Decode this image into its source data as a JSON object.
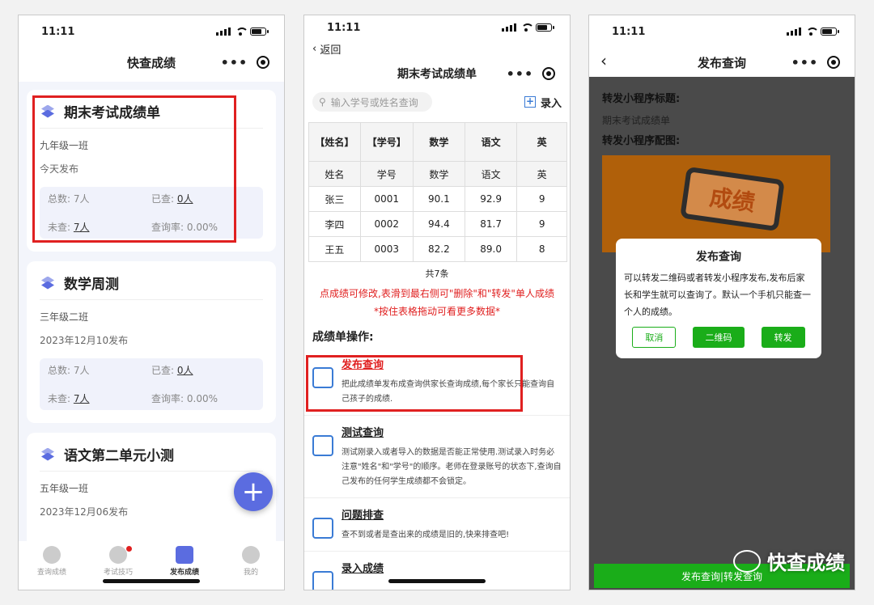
{
  "status": {
    "time": "11:11"
  },
  "screen1": {
    "title": "快查成绩",
    "cards": [
      {
        "title": "期末考试成绩单",
        "class": "九年级一班",
        "date": "今天发布",
        "total_label": "总数:",
        "total": "7人",
        "checked_label": "已查:",
        "checked": "0人",
        "unchecked_label": "未查:",
        "unchecked": "7人",
        "rate_label": "查询率:",
        "rate": "0.00%"
      },
      {
        "title": "数学周测",
        "class": "三年级二班",
        "date": "2023年12月10发布",
        "total_label": "总数:",
        "total": "7人",
        "checked_label": "已查:",
        "checked": "0人",
        "unchecked_label": "未查:",
        "unchecked": "7人",
        "rate_label": "查询率:",
        "rate": "0.00%"
      },
      {
        "title": "语文第二单元小测",
        "class": "五年级一班",
        "date": "2023年12月06发布"
      }
    ],
    "fab": "+",
    "tabs": [
      "查询成绩",
      "考试技巧",
      "发布成绩",
      "我的"
    ]
  },
  "screen2": {
    "back": "返回",
    "title": "期末考试成绩单",
    "search_placeholder": "输入学号或姓名查询",
    "add": "录入",
    "headers": [
      "【姓名】",
      "【学号】",
      "数学",
      "语文",
      "英"
    ],
    "rows": [
      [
        "姓名",
        "学号",
        "数学",
        "语文",
        "英"
      ],
      [
        "张三",
        "0001",
        "90.1",
        "92.9",
        "9"
      ],
      [
        "李四",
        "0002",
        "94.4",
        "81.7",
        "9"
      ],
      [
        "王五",
        "0003",
        "82.2",
        "89.0",
        "8"
      ]
    ],
    "count": "共7条",
    "note1": "点成绩可修改,表滑到最右侧可\"删除\"和\"转发\"单人成绩",
    "note2": "*按住表格拖动可看更多数据*",
    "ops_title": "成绩单操作:",
    "ops": [
      {
        "title": "发布查询",
        "desc": "把此成绩单发布成查询供家长查询成绩,每个家长只能查询自己孩子的成绩."
      },
      {
        "title": "测试查询",
        "desc": "测试刚录入或者导入的数据是否能正常使用.测试录入时务必注意\"姓名\"和\"学号\"的顺序。老师在登录账号的状态下,查询自己发布的任何学生成绩都不会锁定。"
      },
      {
        "title": "问题排查",
        "desc": "查不到或者是查出来的成绩是旧的,快来排查吧!"
      },
      {
        "title": "录入成绩",
        "desc": ""
      }
    ]
  },
  "screen3": {
    "title": "发布查询",
    "label1": "转发小程序标题:",
    "value1": "期末考试成绩单",
    "label2": "转发小程序配图:",
    "img_text": "成绩",
    "modal_title": "发布查询",
    "modal_body": "可以转发二维码或者转发小程序发布,发布后家长和学生就可以查询了。默认一个手机只能查一个人的成绩。",
    "btn_cancel": "取消",
    "btn_qr": "二维码",
    "btn_share": "转发",
    "bottom_btn": "发布查询|转发查询"
  },
  "watermark": "快查成绩"
}
